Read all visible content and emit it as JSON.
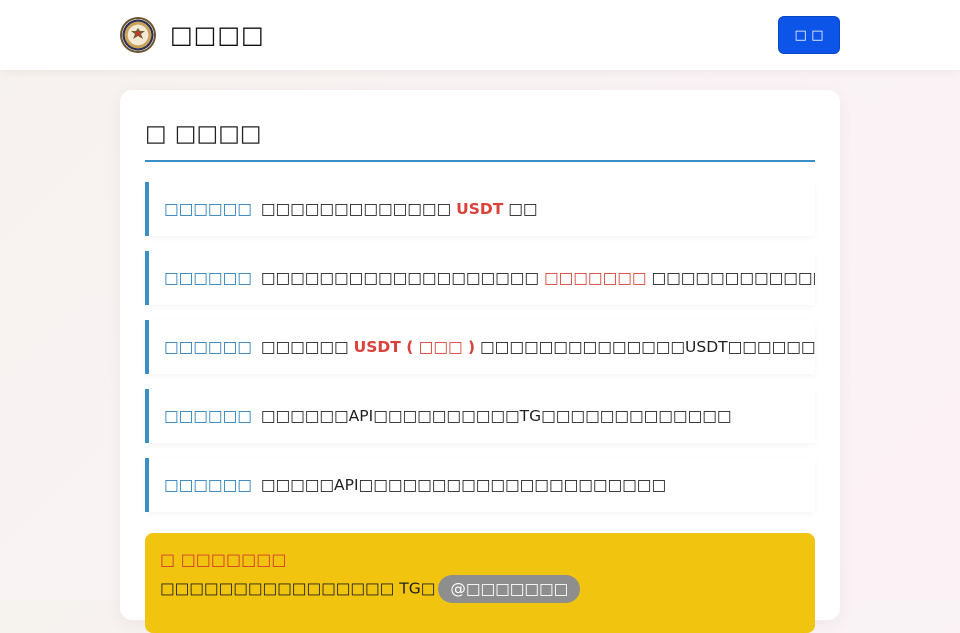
{
  "header": {
    "title": "□□□□",
    "button_label": "□ □"
  },
  "section": {
    "title": "□ □□□□"
  },
  "rules": [
    {
      "tag": "□□□□□□",
      "text_a": "□□□□□□□□□□□□□",
      "highlight": "USDT",
      "text_b": "□□"
    },
    {
      "tag": "□□□□□□",
      "text_a": "□□□□□□□□□□□□□□□□□□□ ",
      "highlight": "□□□□□□□",
      "text_b": "□□□□□□□□□□□□□□□□□□□□□□"
    },
    {
      "tag": "□□□□□□",
      "text_a": "□□□□□□ ",
      "highlight": "USDT ( □□□ )",
      "text_b": " □□□□□□□□□□□□□□USDT□□□□□□□□□"
    },
    {
      "tag": "□□□□□□",
      "text_a": "□□□□□□API□□□□□□□□□□TG□□□□□□□□□□□□□",
      "highlight": "",
      "text_b": ""
    },
    {
      "tag": "□□□□□□",
      "text_a": "□□□□□API□□□□□□□□□□□□□□□□□□□□□",
      "highlight": "",
      "text_b": ""
    }
  ],
  "notice": {
    "title": "□ □□□□□□□",
    "text": "□□□□□□□□□□□□□□□□ TG□",
    "contact": "@□□□□□□□"
  },
  "colors": {
    "accent": "#3a8fc4",
    "highlight": "#d9413a",
    "button": "#0d55e8",
    "notice_bg": "#f1c40f"
  }
}
